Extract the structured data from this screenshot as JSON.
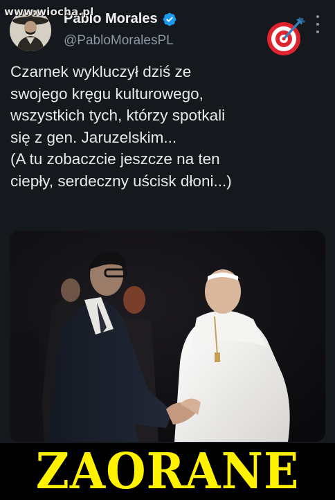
{
  "watermark": "www.wiocha.pl",
  "author": {
    "name": "Pablo Morales",
    "handle": "@PabloMoralesPL"
  },
  "icons": {
    "verified": "verified-badge-icon",
    "target": "bullseye-dart-icon",
    "more": "more-options-icon"
  },
  "tweet": {
    "text": "Czarnek wykluczył dziś ze\nswojego kręgu kulturowego,\nwszystkich tych, którzy spotkali\nsię z gen. Jaruzelskim...\n(A tu zobaczcie jeszcze na ten\nciepły, serdeczny uścisk dłoni...)"
  },
  "colors": {
    "background": "#15181c",
    "banner_text": "#fff200",
    "verified_blue": "#1d9bf0"
  },
  "banner": {
    "text": "ZAORANE"
  }
}
